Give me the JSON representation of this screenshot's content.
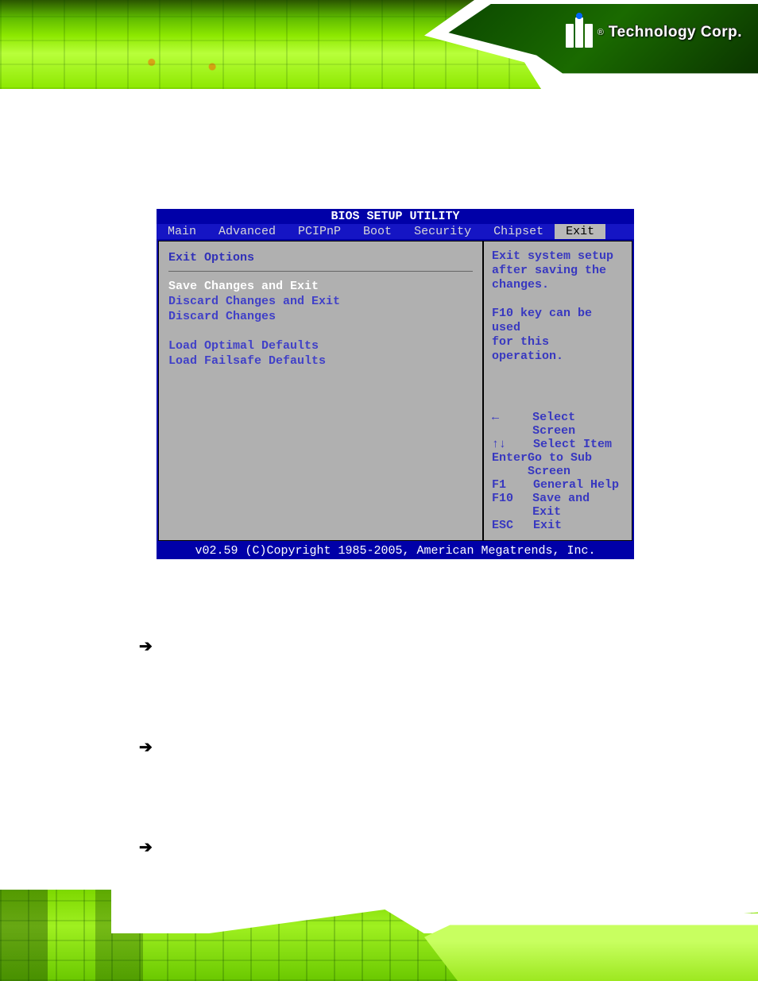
{
  "header": {
    "logo_brand": "Technology Corp.",
    "logo_reg": "®"
  },
  "bios": {
    "title": "BIOS SETUP UTILITY",
    "tabs": [
      "Main",
      "Advanced",
      "PCIPnP",
      "Boot",
      "Security",
      "Chipset",
      "Exit"
    ],
    "active_tab_index": 6,
    "left_panel": {
      "section_title": "Exit Options",
      "items_group1": [
        "Save Changes and Exit",
        "Discard Changes and Exit",
        "Discard Changes"
      ],
      "items_group2": [
        "Load Optimal Defaults",
        "Load Failsafe Defaults"
      ],
      "selected_index": 0
    },
    "right_panel": {
      "help_lines": [
        "Exit system setup",
        "after saving the",
        "changes.",
        "",
        "F10 key can be used",
        "for this operation."
      ],
      "keys": [
        {
          "key": "←",
          "action": "Select Screen"
        },
        {
          "key": "↑↓",
          "action": "Select Item"
        },
        {
          "key": "Enter",
          "action": "Go to Sub Screen"
        },
        {
          "key": "F1",
          "action": "General Help"
        },
        {
          "key": "F10",
          "action": "Save and Exit"
        },
        {
          "key": "ESC",
          "action": "Exit"
        }
      ]
    },
    "footer": "v02.59 (C)Copyright 1985-2005, American Megatrends, Inc."
  },
  "bullets": {
    "arrow": "➔"
  }
}
